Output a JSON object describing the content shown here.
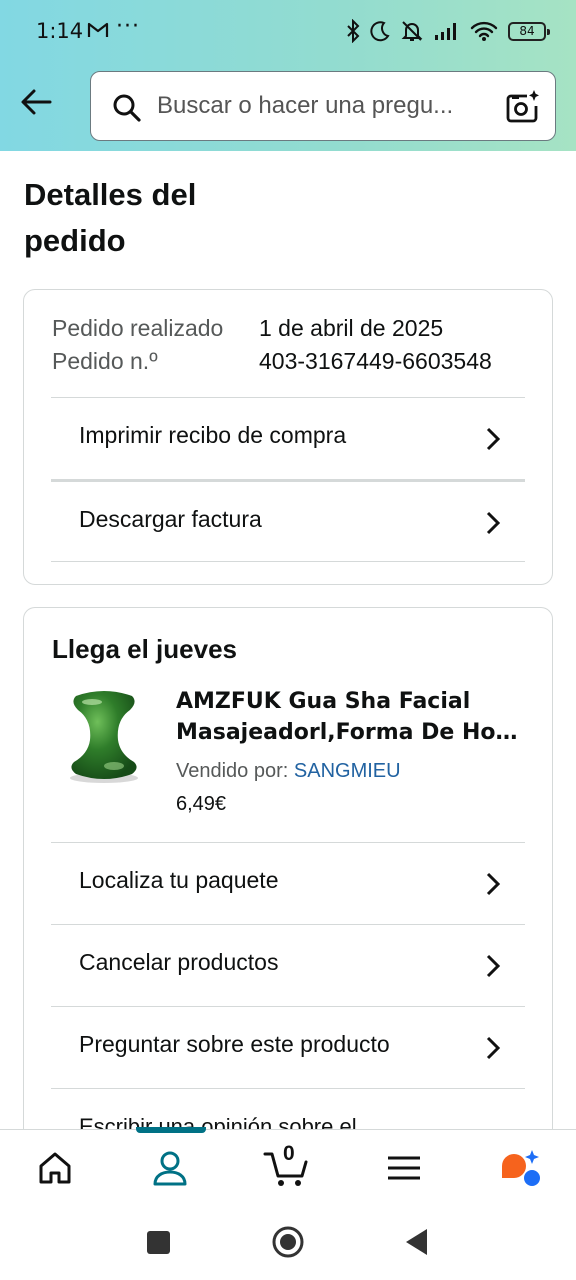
{
  "status_bar": {
    "time": "1:14",
    "dots": "···",
    "battery": "84"
  },
  "search": {
    "placeholder": "Buscar o hacer una pregu..."
  },
  "page": {
    "title": "Detalles del pedido"
  },
  "order": {
    "placed_label": "Pedido realizado",
    "placed_value": "1 de abril de 2025",
    "number_label": "Pedido n.º",
    "number_value": "403-3167449-6603548",
    "actions": [
      {
        "label": "Imprimir recibo de compra"
      },
      {
        "label": "Descargar factura"
      }
    ]
  },
  "shipment": {
    "heading": "Llega el jueves",
    "product": {
      "name_line1": "AMZFUK Gua Sha Facial",
      "name_line2": "Masajeadorl,Forma De Hong...",
      "sold_by_label": "Vendido por:",
      "seller": "SANGMIEU",
      "price": "6,49€"
    },
    "actions": [
      {
        "label": "Localiza tu paquete"
      },
      {
        "label": "Cancelar productos"
      },
      {
        "label": "Preguntar sobre este producto"
      }
    ],
    "cut_off_action": "Escribir una opinión sobre el"
  },
  "bottom_nav": {
    "cart_count": "0",
    "items": [
      "home-icon",
      "account-icon",
      "cart-icon",
      "menu-icon",
      "rufus-icon"
    ],
    "accent": "#007185"
  }
}
